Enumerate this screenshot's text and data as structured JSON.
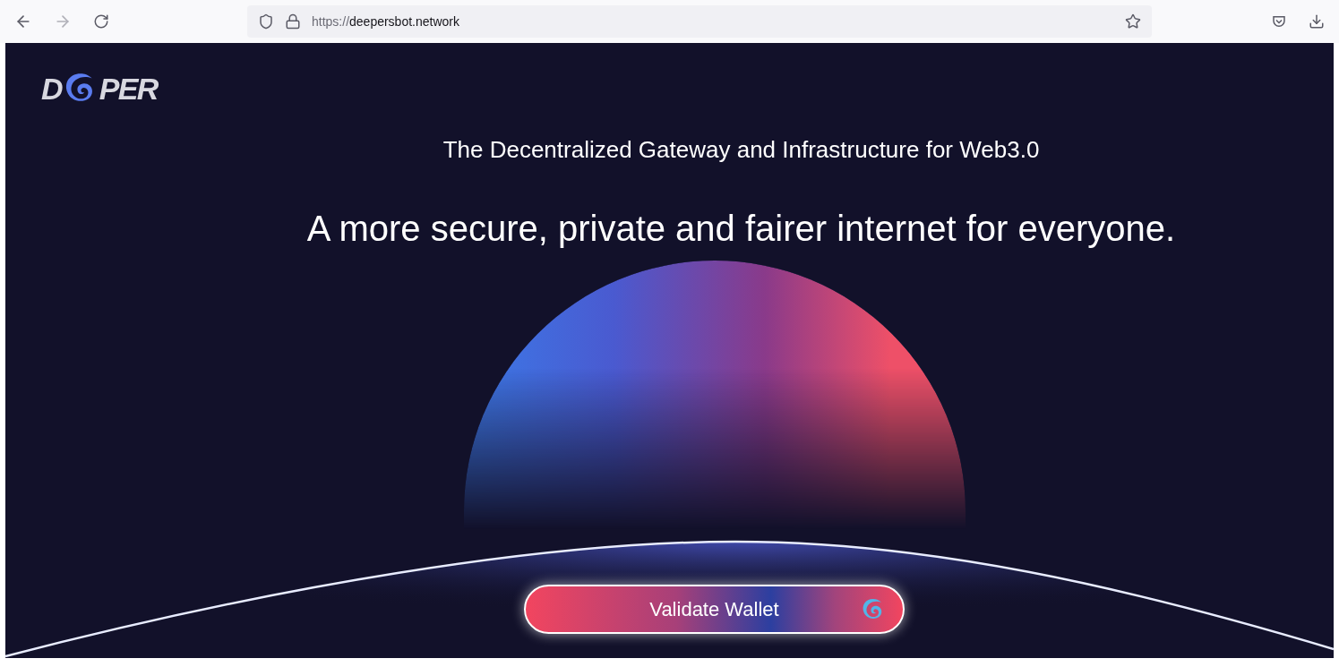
{
  "browser": {
    "url_scheme": "https://",
    "url_host": "deepersbot.network"
  },
  "logo": {
    "text_start": "D",
    "text_end": "PER"
  },
  "tagline": "The Decentralized Gateway and Infrastructure for Web3.0",
  "headline": "A more secure, private and fairer internet for everyone.",
  "cta_button": {
    "label": "Validate Wallet"
  }
}
